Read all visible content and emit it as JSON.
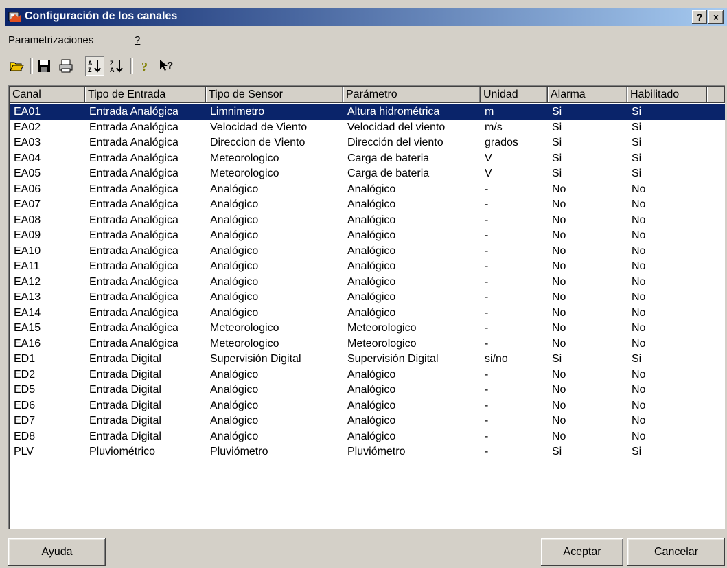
{
  "window": {
    "title": "Configuración de los canales",
    "help_button": "?",
    "close_button": "×"
  },
  "menu": [
    {
      "label": "Parametrizaciones"
    },
    {
      "label": "?"
    }
  ],
  "toolbar": [
    "open-icon",
    "save-icon",
    "print-icon",
    "sort-ascending-icon",
    "sort-descending-icon",
    "help-icon",
    "context-help-icon"
  ],
  "columns": [
    "Canal",
    "Tipo de Entrada",
    "Tipo de Sensor",
    "Parámetro",
    "Unidad",
    "Alarma",
    "Habilitado"
  ],
  "rows": [
    [
      "EA01",
      "Entrada Analógica",
      "Limnimetro",
      "Altura hidrométrica",
      "m",
      "Si",
      "Si"
    ],
    [
      "EA02",
      "Entrada Analógica",
      "Velocidad de Viento",
      "Velocidad del viento",
      "m/s",
      "Si",
      "Si"
    ],
    [
      "EA03",
      "Entrada Analógica",
      "Direccion de Viento",
      "Dirección del viento",
      "grados",
      "Si",
      "Si"
    ],
    [
      "EA04",
      "Entrada Analógica",
      "Meteorologico",
      "Carga de bateria",
      "V",
      "Si",
      "Si"
    ],
    [
      "EA05",
      "Entrada Analógica",
      "Meteorologico",
      "Carga de bateria",
      "V",
      "Si",
      "Si"
    ],
    [
      "EA06",
      "Entrada Analógica",
      "Analógico",
      "Analógico",
      "-",
      "No",
      "No"
    ],
    [
      "EA07",
      "Entrada Analógica",
      "Analógico",
      "Analógico",
      "-",
      "No",
      "No"
    ],
    [
      "EA08",
      "Entrada Analógica",
      "Analógico",
      "Analógico",
      "-",
      "No",
      "No"
    ],
    [
      "EA09",
      "Entrada Analógica",
      "Analógico",
      "Analógico",
      "-",
      "No",
      "No"
    ],
    [
      "EA10",
      "Entrada Analógica",
      "Analógico",
      "Analógico",
      "-",
      "No",
      "No"
    ],
    [
      "EA11",
      "Entrada Analógica",
      "Analógico",
      "Analógico",
      "-",
      "No",
      "No"
    ],
    [
      "EA12",
      "Entrada Analógica",
      "Analógico",
      "Analógico",
      "-",
      "No",
      "No"
    ],
    [
      "EA13",
      "Entrada Analógica",
      "Analógico",
      "Analógico",
      "-",
      "No",
      "No"
    ],
    [
      "EA14",
      "Entrada Analógica",
      "Analógico",
      "Analógico",
      "-",
      "No",
      "No"
    ],
    [
      "EA15",
      "Entrada Analógica",
      "Meteorologico",
      "Meteorologico",
      "-",
      "No",
      "No"
    ],
    [
      "EA16",
      "Entrada Analógica",
      "Meteorologico",
      "Meteorologico",
      "-",
      "No",
      "No"
    ],
    [
      "ED1",
      "Entrada Digital",
      "Supervisión Digital",
      "Supervisión Digital",
      "si/no",
      "Si",
      "Si"
    ],
    [
      "ED2",
      "Entrada Digital",
      "Analógico",
      "Analógico",
      "-",
      "No",
      "No"
    ],
    [
      "ED5",
      "Entrada Digital",
      "Analógico",
      "Analógico",
      "-",
      "No",
      "No"
    ],
    [
      "ED6",
      "Entrada Digital",
      "Analógico",
      "Analógico",
      "-",
      "No",
      "No"
    ],
    [
      "ED7",
      "Entrada Digital",
      "Analógico",
      "Analógico",
      "-",
      "No",
      "No"
    ],
    [
      "ED8",
      "Entrada Digital",
      "Analógico",
      "Analógico",
      "-",
      "No",
      "No"
    ],
    [
      "PLV",
      "Pluviométrico",
      "Pluviómetro",
      "Pluviómetro",
      "-",
      "Si",
      "Si"
    ]
  ],
  "selected_row": 0,
  "buttons": {
    "help": "Ayuda",
    "accept": "Aceptar",
    "cancel": "Cancelar"
  },
  "colors": {
    "title_start": "#0a246a",
    "title_end": "#a6caf0",
    "selection": "#0a246a",
    "face": "#d4d0c8"
  }
}
